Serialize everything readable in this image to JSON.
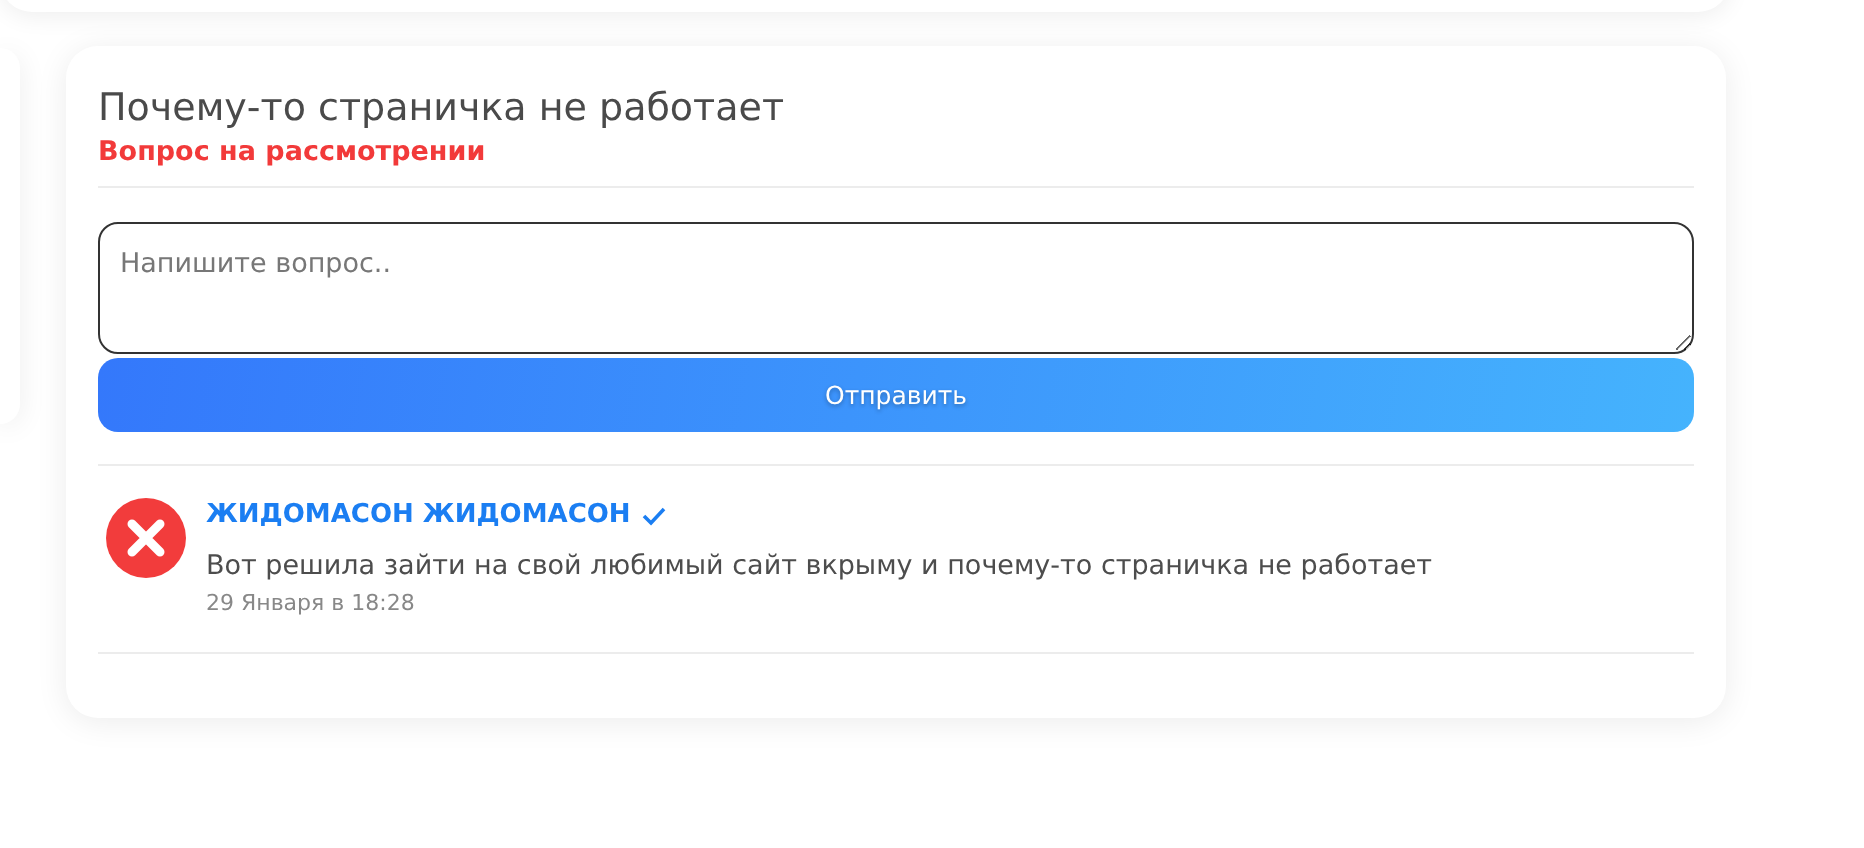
{
  "question": {
    "title": "Почему-то страничка не работает",
    "status": "Вопрос на рассмотрении"
  },
  "reply_form": {
    "placeholder": "Напишите вопрос..",
    "submit_label": "Отправить"
  },
  "comments": [
    {
      "author": "ЖИДОМАСОН ЖИДОМАСОН",
      "verified": true,
      "text": "Вот решила зайти на свой любимый сайт вкрыму и почему-то страничка не работает",
      "date": "29 Января в 18:28"
    }
  ]
}
